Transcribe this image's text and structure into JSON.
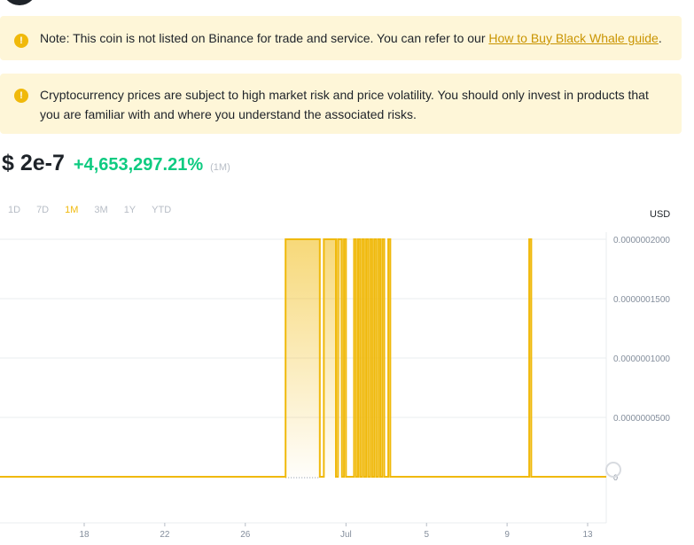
{
  "notices": [
    {
      "text_before": "Note: This coin is not listed on Binance for trade and service. You can refer to our ",
      "link_text": "How to Buy Black Whale guide",
      "text_after": "."
    },
    {
      "text": "Cryptocurrency prices are subject to high market risk and price volatility. You should only invest in products that you are familiar with and where you understand the associated risks."
    }
  ],
  "warning_icon_glyph": "!",
  "price": "$ 2e-7",
  "change": "+4,653,297.21%",
  "period": "(1M)",
  "range_tabs": [
    "1D",
    "7D",
    "1M",
    "3M",
    "1Y",
    "YTD"
  ],
  "active_tab": "1M",
  "currency": "USD",
  "colors": {
    "accent": "#f0b90b",
    "positive": "#0ecb81",
    "notice_bg": "#fef6d8"
  },
  "chart_data": {
    "type": "line",
    "ylabel": "USD",
    "y_ticks": [
      "0.0000002000",
      "0.0000001500",
      "0.0000001000",
      "0.0000000500"
    ],
    "y_tick_values": [
      2e-07,
      1.5e-07,
      1e-07,
      5e-08
    ],
    "zero_label": "0",
    "ylim": [
      0,
      2e-07
    ],
    "x_ticks": [
      "18",
      "22",
      "26",
      "Jul",
      "5",
      "9",
      "13"
    ],
    "series": [
      {
        "values_description": "near-zero baseline with spikes to 2e-7 between late June and early July, and one spike around 10 Jul",
        "spikes": [
          {
            "start": "Jun 28",
            "end": "Jun 29.7"
          },
          {
            "start": "Jun 29.9",
            "end": "Jun 30.5"
          },
          {
            "start": "Jun 30.6",
            "end": "Jun 30.8"
          },
          {
            "start": "Jun 30.9",
            "end": "Jul 1.0"
          },
          {
            "start": "Jul 1.4",
            "end": "Jul 1.5"
          },
          {
            "start": "Jul 1.6",
            "end": "Jul 1.7"
          },
          {
            "start": "Jul 1.8",
            "end": "Jul 1.9"
          },
          {
            "start": "Jul 2.0",
            "end": "Jul 2.1"
          },
          {
            "start": "Jul 2.2",
            "end": "Jul 2.3"
          },
          {
            "start": "Jul 2.4",
            "end": "Jul 2.5"
          },
          {
            "start": "Jul 2.6",
            "end": "Jul 2.7"
          },
          {
            "start": "Jul 2.8",
            "end": "Jul 2.9"
          },
          {
            "start": "Jul 3.1",
            "end": "Jul 3.2"
          },
          {
            "start": "Jul 10.1",
            "end": "Jul 10.2"
          }
        ]
      }
    ],
    "grid": true
  }
}
